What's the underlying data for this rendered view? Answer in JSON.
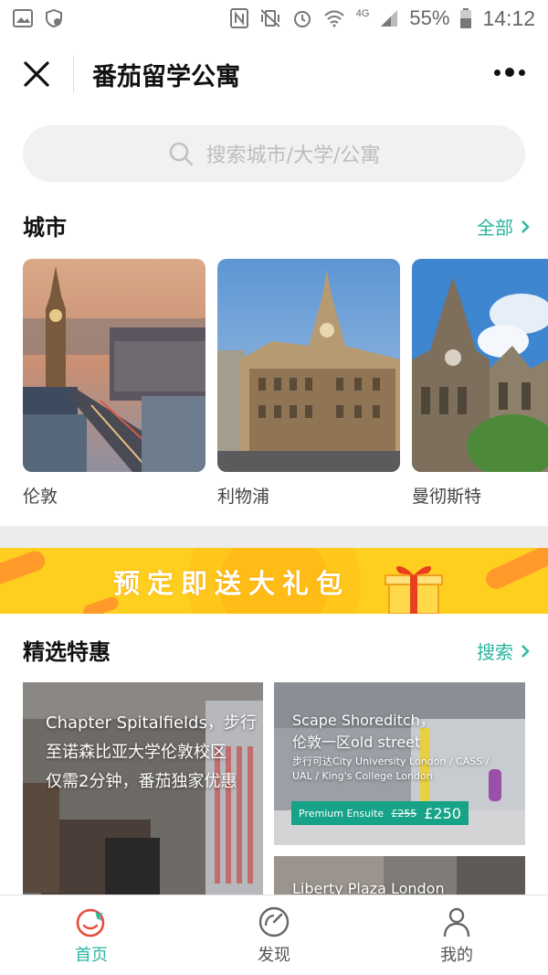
{
  "status_bar": {
    "battery": "55%",
    "time": "14:12",
    "network": "4G",
    "icons": [
      "image-icon",
      "shield-icon",
      "nfc-icon",
      "vibrate-icon",
      "alarm-icon",
      "wifi-icon",
      "signal-icon",
      "battery-icon"
    ]
  },
  "header": {
    "title": "番茄留学公寓",
    "close_icon": "close-icon",
    "more_icon": "more-icon"
  },
  "search": {
    "placeholder": "搜索城市/大学/公寓"
  },
  "cities_section": {
    "title": "城市",
    "link": "全部",
    "items": [
      {
        "label": "伦敦"
      },
      {
        "label": "利物浦"
      },
      {
        "label": "曼彻斯特"
      }
    ]
  },
  "banner": {
    "text": "预定即送大礼包"
  },
  "deals_section": {
    "title": "精选特惠",
    "link": "搜索",
    "cards": [
      {
        "line1": "Chapter Spitalfields，步行",
        "line2": "至诺森比亚大学伦敦校区",
        "line3": "仅需2分钟，番茄独家优惠"
      },
      {
        "line1": "Scape Shoreditch，",
        "line2": "伦敦一区old street",
        "line3": "步行可达City University London / CASS /",
        "line4": "UAL / King's College London",
        "badge_type": "Premium Ensuite",
        "old_price": "£255",
        "price": "£250"
      },
      {
        "line1": "Liberty Plaza London"
      }
    ]
  },
  "bottom_nav": {
    "items": [
      {
        "label": "首页",
        "icon": "home-tomato-icon",
        "active": true
      },
      {
        "label": "发现",
        "icon": "compass-icon",
        "active": false
      },
      {
        "label": "我的",
        "icon": "user-icon",
        "active": false
      }
    ]
  },
  "colors": {
    "accent": "#2bb5a1",
    "banner": "#ffcf1f",
    "nav_active_icon": "#e94b3c"
  }
}
